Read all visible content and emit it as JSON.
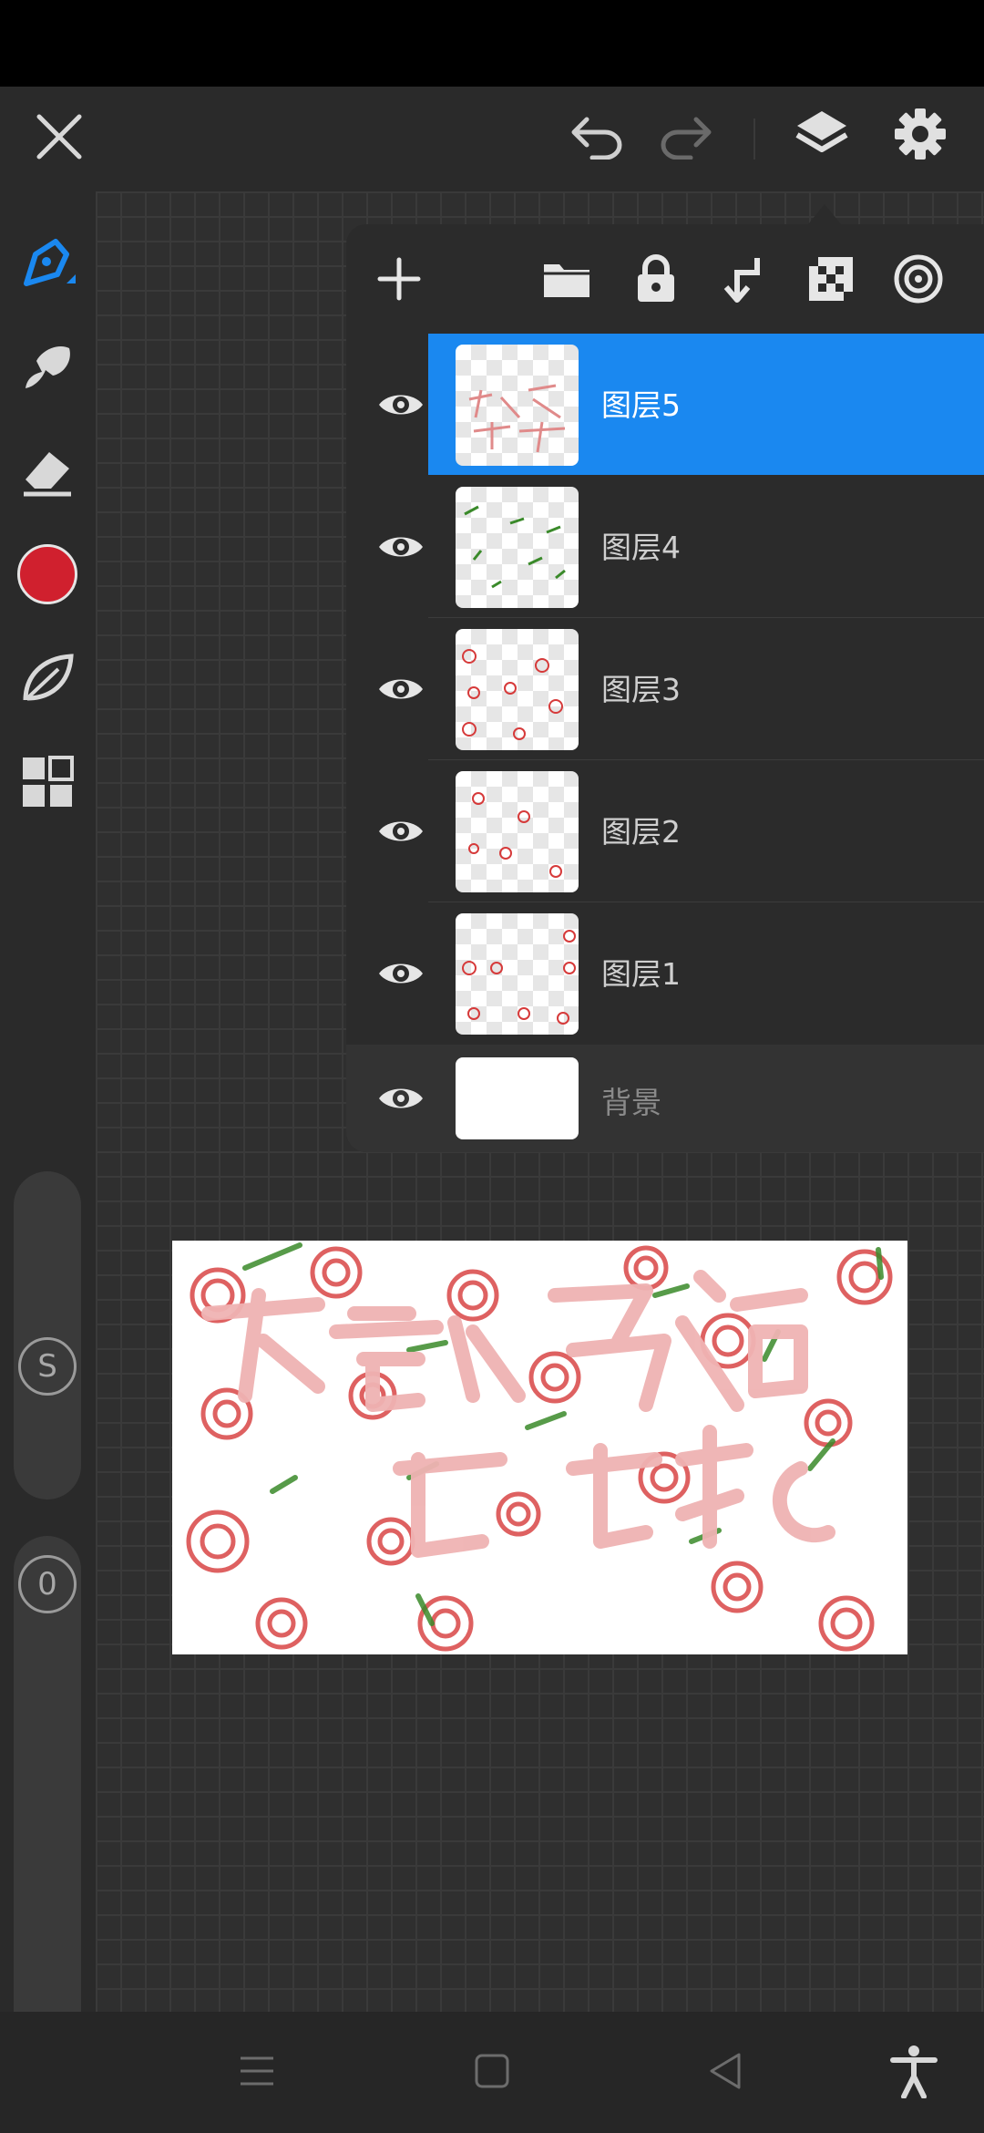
{
  "toolbar": {
    "close_icon": "close-icon",
    "undo_icon": "undo-icon",
    "redo_icon": "redo-icon",
    "layers_icon": "layers-icon",
    "settings_icon": "gear-icon"
  },
  "tools": [
    {
      "name": "brush-icon",
      "active": true
    },
    {
      "name": "smudge-icon",
      "active": false
    },
    {
      "name": "eraser-icon",
      "active": false
    },
    {
      "name": "color-swatch",
      "active": false
    },
    {
      "name": "leaf-brush-library-icon",
      "active": false
    },
    {
      "name": "grid-icon",
      "active": false
    }
  ],
  "colors": {
    "accent": "#1a88f0",
    "current_color": "#d0202e",
    "background": "#2a2a2a"
  },
  "sliders": {
    "size_label": "S",
    "opacity_label": "0"
  },
  "layers_panel": {
    "buttons": [
      "add-icon",
      "folder-icon",
      "lock-icon",
      "merge-down-icon",
      "alpha-lock-icon",
      "blend-icon"
    ],
    "layers": [
      {
        "name": "图层5",
        "selected": true,
        "visible": true
      },
      {
        "name": "图层4",
        "selected": false,
        "visible": true
      },
      {
        "name": "图层3",
        "selected": false,
        "visible": true
      },
      {
        "name": "图层2",
        "selected": false,
        "visible": true
      },
      {
        "name": "图层1",
        "selected": false,
        "visible": true
      }
    ],
    "background_layer": {
      "name": "背景",
      "visible": true
    }
  },
  "navbar": {
    "icons": [
      "menu-icon",
      "home-icon",
      "back-icon",
      "accessibility-icon"
    ]
  }
}
